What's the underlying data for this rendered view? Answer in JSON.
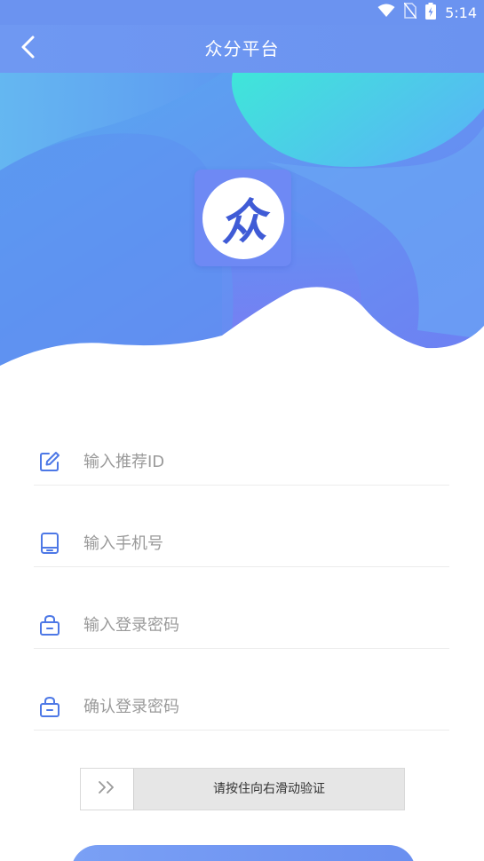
{
  "status_bar": {
    "time": "5:14"
  },
  "header": {
    "title": "众分平台"
  },
  "logo": {
    "glyph": "众"
  },
  "form": {
    "referral_placeholder": "输入推荐ID",
    "phone_placeholder": "输入手机号",
    "password_placeholder": "输入登录密码",
    "confirm_password_placeholder": "确认登录密码"
  },
  "slider": {
    "text": "请按住向右滑动验证",
    "handle_symbol": "››"
  },
  "colors": {
    "primary": "#6b93f0",
    "accent_cyan": "#4fe0dc",
    "icon_blue": "#4d78e6",
    "placeholder_gray": "#9a9a9a"
  },
  "icons": {
    "back": "chevron-left-icon",
    "referral": "edit-icon",
    "phone": "phone-icon",
    "password": "lock-icon",
    "confirm": "lock-icon",
    "slider": "double-chevron-right-icon"
  }
}
